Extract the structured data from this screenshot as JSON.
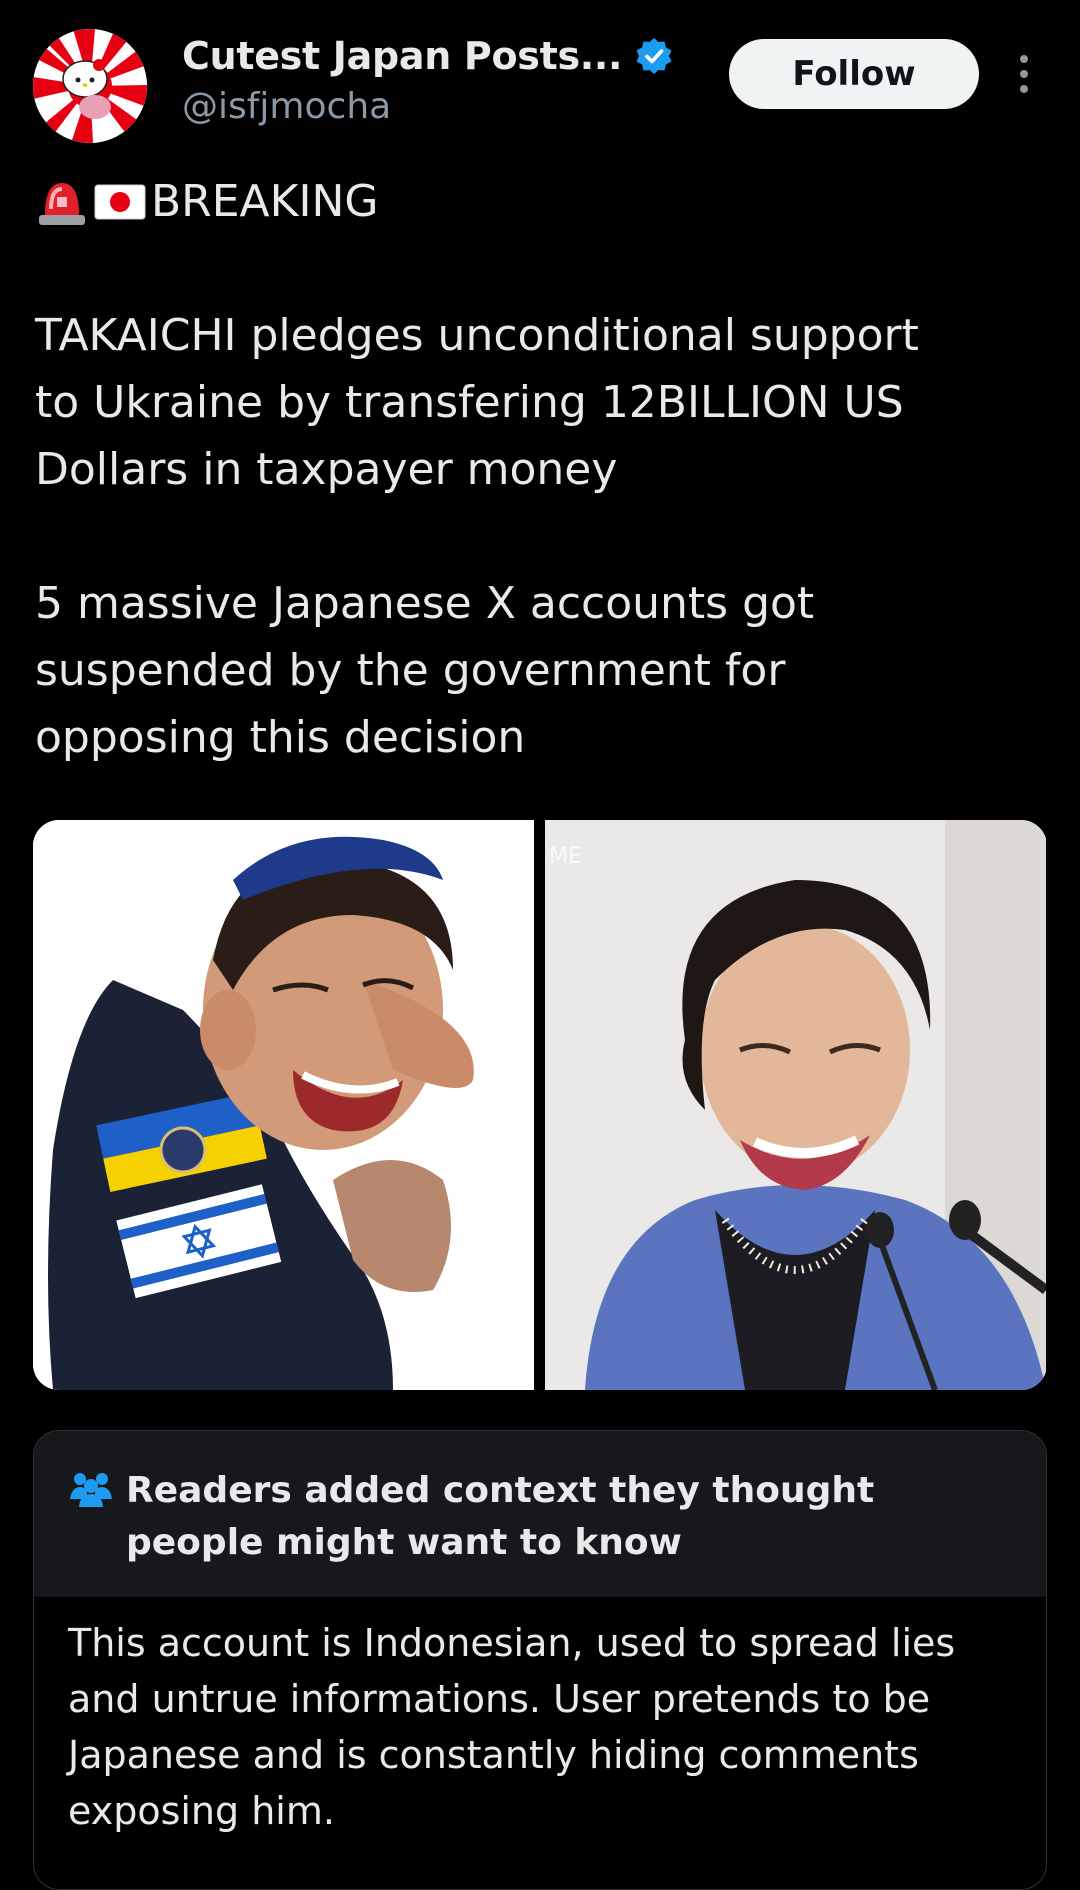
{
  "author": {
    "display_name": "Cutest Japan Posts...",
    "handle": "@isfjmocha",
    "verified": true
  },
  "actions": {
    "follow_label": "Follow"
  },
  "tweet": {
    "breaking_label": "BREAKING",
    "lines": [
      "TAKAICHI pledges unconditional support",
      "to Ukraine by transfering 12BILLION US",
      "Dollars in taxpayer money",
      "5 massive Japanese X accounts got",
      "suspended by the government for",
      "opposing this decision"
    ]
  },
  "media": {
    "right_watermark": "ME"
  },
  "community_note": {
    "title": "Readers added context they thought people might want to know",
    "body": "This account is Indonesian, used to spread lies and untrue informations. User pretends to be Japanese and is constantly hiding comments exposing him."
  },
  "colors": {
    "background": "#000000",
    "text": "#e7e9ea",
    "secondary_text": "#8b98a5",
    "verified_blue": "#1d9bf0",
    "note_header_bg": "#16181c"
  }
}
